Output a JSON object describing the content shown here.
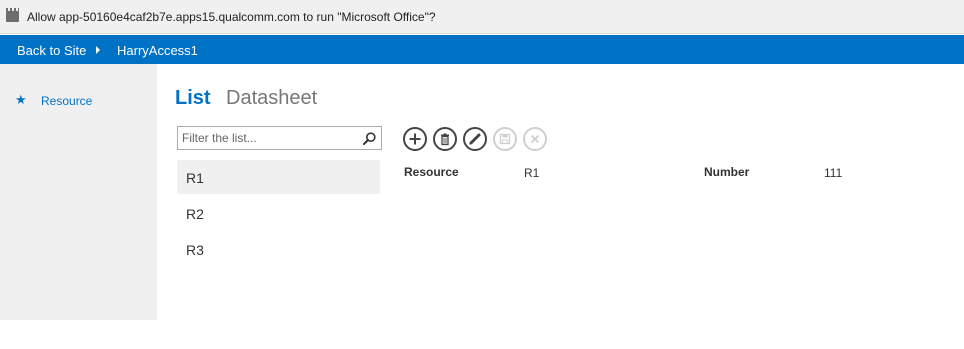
{
  "notification": {
    "text": "Allow app-50160e4caf2b7e.apps15.qualcomm.com to run \"Microsoft Office\"?"
  },
  "topbar": {
    "back_label": "Back to Site",
    "app_name": "HarryAccess1"
  },
  "sidebar": {
    "items": [
      {
        "label": "Resource",
        "icon": "star-icon"
      }
    ]
  },
  "views": {
    "list_label": "List",
    "datasheet_label": "Datasheet"
  },
  "search": {
    "placeholder": "Filter the list...",
    "value": ""
  },
  "list": {
    "items": [
      "R1",
      "R2",
      "R3"
    ],
    "selected": "R1"
  },
  "actions": [
    {
      "name": "add",
      "icon": "plus-icon",
      "enabled": true
    },
    {
      "name": "delete",
      "icon": "trash-icon",
      "enabled": true
    },
    {
      "name": "edit",
      "icon": "pencil-icon",
      "enabled": true
    },
    {
      "name": "save",
      "icon": "floppy-icon",
      "enabled": false
    },
    {
      "name": "cancel",
      "icon": "x-icon",
      "enabled": false
    }
  ],
  "detail": {
    "fields": [
      {
        "label": "Resource",
        "value": "R1"
      },
      {
        "label": "Number",
        "value": "111"
      }
    ]
  },
  "colors": {
    "accent": "#0072c6",
    "sidebar_bg": "#f0f0f0",
    "selected_bg": "#f0f0f0",
    "disabled": "#cfcfcf"
  }
}
